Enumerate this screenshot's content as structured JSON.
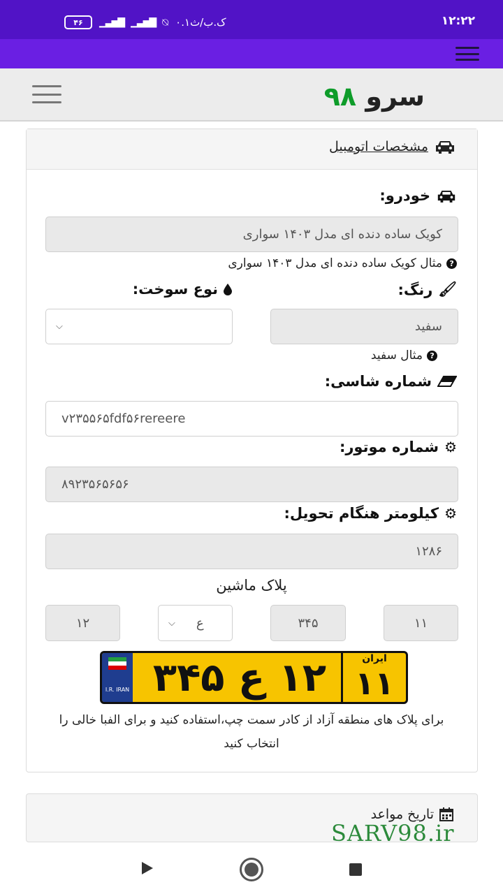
{
  "status_bar": {
    "time": "۱۲:۲۲",
    "network_speed": "۰.۱ک.ب/ث",
    "battery": "۴۶"
  },
  "header": {
    "logo_text": "سرو",
    "logo_number": "۹۸"
  },
  "vehicle_card": {
    "title": "مشخصات اتومبیل",
    "car_label": "خودرو:",
    "car_value": "کویک ساده دنده ای مدل ۱۴۰۳ سواری",
    "car_hint": "مثال کویک ساده دنده ای مدل ۱۴۰۳ سواری",
    "color_label": "رنگ:",
    "color_value": "سفید",
    "color_hint": "مثال سفید",
    "fuel_label": "نوع سوخت:",
    "fuel_value": "",
    "chassis_label": "شماره شاسی:",
    "chassis_value": "v۲۳۵۵۶۵fdf۵۶rereere",
    "engine_label": "شماره موتور:",
    "engine_value": "۸۹۲۳۵۶۵۶۵۶",
    "km_label": "کیلومتر هنگام تحویل:",
    "km_value": "۱۲۸۶"
  },
  "plate": {
    "title": "پلاک ماشین",
    "field_region": "۱۱",
    "field_three_digits": "۳۴۵",
    "field_letter": "ع",
    "field_two_digits": "۱۲",
    "image_main": "۱۲ ع ۳۴۵",
    "image_region": "۱۱",
    "image_country": "ایران",
    "image_flag_text": "I.R. IRAN",
    "note": "برای پلاک های منطقه آزاد از کادر سمت چپ،استفاده کنید و برای الفبا خالی را انتخاب کنید"
  },
  "appointments_card": {
    "title": "تاریخ مواعد"
  },
  "watermark": "SARV98.ir",
  "colors": {
    "status_bar": "#5113c6",
    "toolbar": "#6a1fe3",
    "logo_green": "#0e9c2a",
    "plate_yellow": "#f7c400",
    "watermark": "#2c8a3b"
  }
}
